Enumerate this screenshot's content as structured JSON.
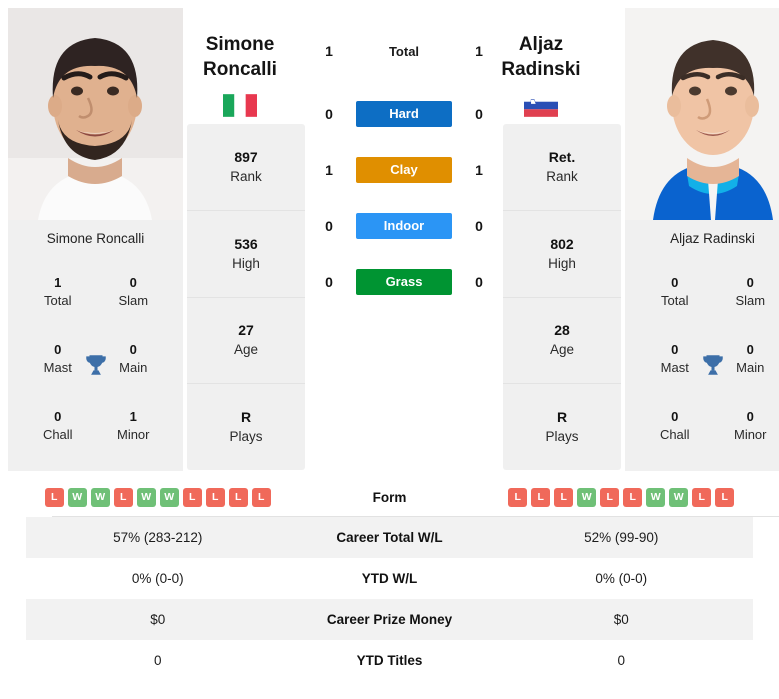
{
  "players": {
    "left": {
      "first_name": "Simone",
      "last_name": "Roncalli",
      "full_name": "Simone Roncalli",
      "country": "Italy",
      "flag_icon": "flag-italy-icon",
      "photo_alt": "Simone Roncalli headshot",
      "stats": [
        {
          "value": "897",
          "label": "Rank"
        },
        {
          "value": "536",
          "label": "High"
        },
        {
          "value": "27",
          "label": "Age"
        },
        {
          "value": "R",
          "label": "Plays"
        }
      ],
      "titles": [
        {
          "value": "1",
          "label": "Total"
        },
        {
          "value": "0",
          "label": "Slam"
        },
        {
          "value": "0",
          "label": "Mast"
        },
        {
          "value": "0",
          "label": "Main"
        },
        {
          "value": "0",
          "label": "Chall"
        },
        {
          "value": "1",
          "label": "Minor"
        }
      ],
      "h2h": {
        "total": "1",
        "hard": "0",
        "clay": "1",
        "indoor": "0",
        "grass": "0"
      },
      "form": [
        "L",
        "W",
        "W",
        "L",
        "W",
        "W",
        "L",
        "L",
        "L",
        "L"
      ],
      "career_total_wl": "57% (283-212)",
      "ytd_wl": "0% (0-0)",
      "career_prize_money": "$0",
      "ytd_titles": "0"
    },
    "right": {
      "first_name": "Aljaz",
      "last_name": "Radinski",
      "full_name": "Aljaz Radinski",
      "country": "Slovenia",
      "flag_icon": "flag-slovenia-icon",
      "photo_alt": "Aljaz Radinski headshot",
      "stats": [
        {
          "value": "Ret.",
          "label": "Rank"
        },
        {
          "value": "802",
          "label": "High"
        },
        {
          "value": "28",
          "label": "Age"
        },
        {
          "value": "R",
          "label": "Plays"
        }
      ],
      "titles": [
        {
          "value": "0",
          "label": "Total"
        },
        {
          "value": "0",
          "label": "Slam"
        },
        {
          "value": "0",
          "label": "Mast"
        },
        {
          "value": "0",
          "label": "Main"
        },
        {
          "value": "0",
          "label": "Chall"
        },
        {
          "value": "0",
          "label": "Minor"
        }
      ],
      "h2h": {
        "total": "1",
        "hard": "0",
        "clay": "1",
        "indoor": "0",
        "grass": "0"
      },
      "form": [
        "L",
        "L",
        "L",
        "W",
        "L",
        "L",
        "W",
        "W",
        "L",
        "L"
      ],
      "career_total_wl": "52% (99-90)",
      "ytd_wl": "0% (0-0)",
      "career_prize_money": "$0",
      "ytd_titles": "0"
    }
  },
  "surfaces": [
    {
      "key": "total",
      "label": "Total",
      "color": "",
      "text_color": "#1a1a1a",
      "plain": true
    },
    {
      "key": "hard",
      "label": "Hard",
      "color": "#0d6ec4",
      "text_color": "#ffffff",
      "plain": false
    },
    {
      "key": "clay",
      "label": "Clay",
      "color": "#e08f00",
      "text_color": "#ffffff",
      "plain": false
    },
    {
      "key": "indoor",
      "label": "Indoor",
      "color": "#2b95f5",
      "text_color": "#ffffff",
      "plain": false
    },
    {
      "key": "grass",
      "label": "Grass",
      "color": "#009432",
      "text_color": "#ffffff",
      "plain": false
    }
  ],
  "table": {
    "rows": [
      {
        "label": "Form",
        "type": "form"
      },
      {
        "label": "Career Total W/L",
        "type": "text",
        "key": "career_total_wl"
      },
      {
        "label": "YTD W/L",
        "type": "text",
        "key": "ytd_wl"
      },
      {
        "label": "Career Prize Money",
        "type": "text",
        "key": "career_prize_money"
      },
      {
        "label": "YTD Titles",
        "type": "text",
        "key": "ytd_titles"
      }
    ]
  },
  "colors": {
    "hard": "#0d6ec4",
    "clay": "#e08f00",
    "indoor": "#2b95f5",
    "grass": "#009432",
    "win_badge": "#6fc077",
    "loss_badge": "#f0695a",
    "trophy": "#3d6fa8",
    "card_bg": "#f0f0f0",
    "row_stripe": "#f2f2f2"
  },
  "icons": {
    "trophy": "trophy-icon",
    "flag_left": "flag-italy-icon",
    "flag_right": "flag-slovenia-icon"
  }
}
